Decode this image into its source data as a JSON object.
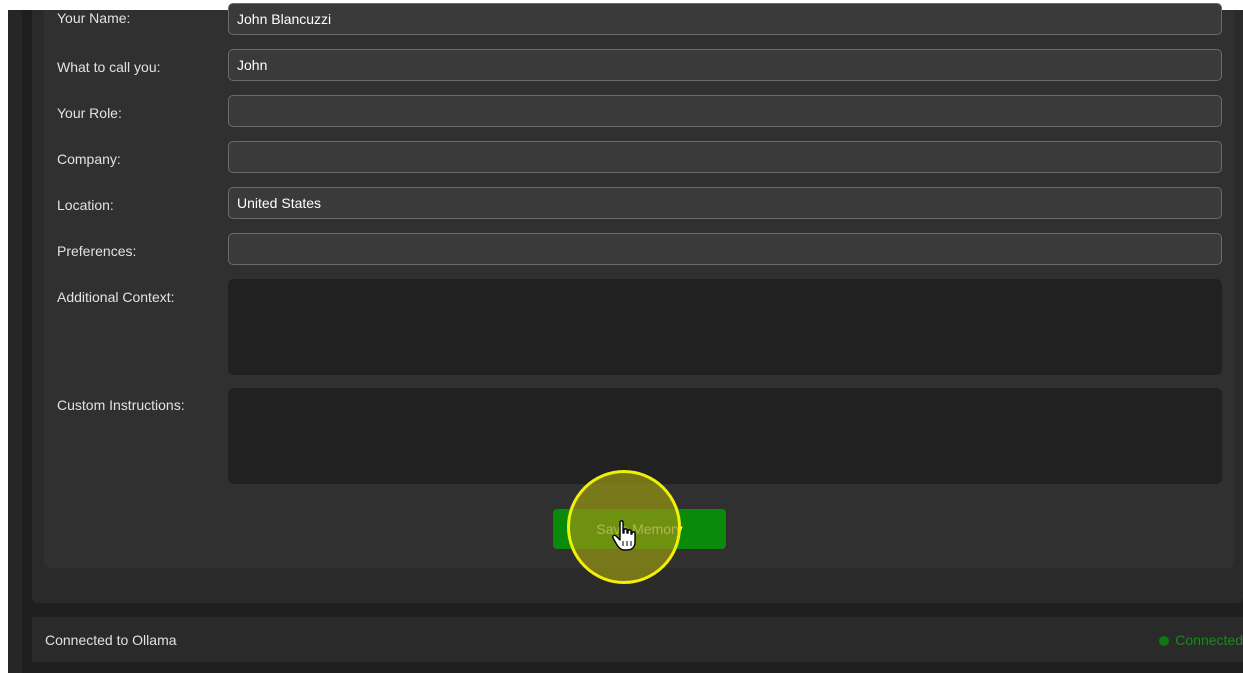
{
  "form": {
    "fields": [
      {
        "label": "Your Name:",
        "value": "John Blancuzzi",
        "placeholder": ""
      },
      {
        "label": "What to call you:",
        "value": "John",
        "placeholder": ""
      },
      {
        "label": "Your Role:",
        "value": "",
        "placeholder": ""
      },
      {
        "label": "Company:",
        "value": "",
        "placeholder": ""
      },
      {
        "label": "Location:",
        "value": "United States",
        "placeholder": ""
      },
      {
        "label": "Preferences:",
        "value": "",
        "placeholder": ""
      }
    ],
    "textareas": [
      {
        "label": "Additional Context:",
        "value": ""
      },
      {
        "label": "Custom Instructions:",
        "value": ""
      }
    ],
    "save_label": "Save Memory"
  },
  "status": {
    "text": "Connected to Ollama",
    "connection_label": "Connected",
    "connection_color": "#0d7a0d"
  },
  "overlay": {
    "cursor_icon": "hand-pointer-icon",
    "highlight_color": "#f2ef0a"
  }
}
